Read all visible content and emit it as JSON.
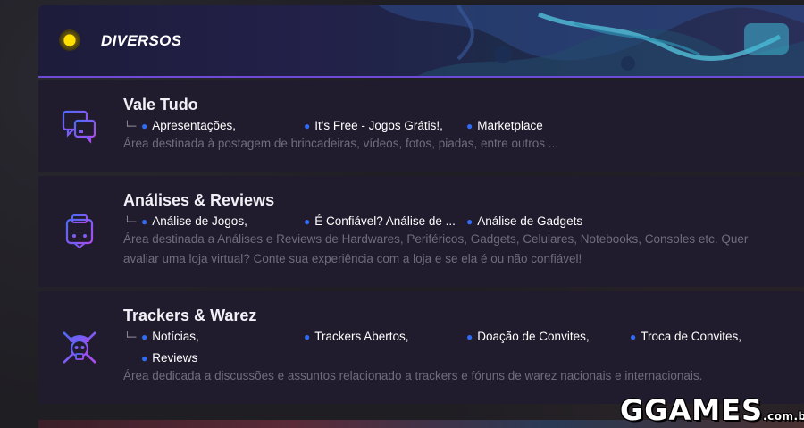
{
  "category": {
    "title": "DIVERSOS"
  },
  "forums": [
    {
      "title": "Vale Tudo",
      "icon": "chat-bubbles-icon",
      "subforums": [
        "Apresentações,",
        "It's Free - Jogos Grátis!,",
        "Marketplace"
      ],
      "description": "Área destinada à postagem de brincadeiras, vídeos, fotos, piadas, entre outros ..."
    },
    {
      "title": "Análises & Reviews",
      "icon": "robot-chip-icon",
      "subforums": [
        "Análise de Jogos,",
        "É Confiável? Análise de ...",
        "Análise de Gadgets"
      ],
      "description_line1": "Área destinada a Análises e Reviews de Hardwares, Periféricos, Gadgets, Celulares, Notebooks, Consoles etc. Quer",
      "description_line2": "avaliar uma loja virtual? Conte sua experiência com a loja e se ela é ou não confiável!"
    },
    {
      "title": "Trackers & Warez",
      "icon": "pirate-skull-icon",
      "subforums": [
        "Notícias,",
        "Trackers Abertos,",
        "Doação de Convites,",
        "Troca de Convites,",
        "Reviews"
      ],
      "description": "Área dedicada a discussões e assuntos relacionado a trackers e fóruns de warez nacionais e internacionais."
    }
  ],
  "watermark": {
    "main": "GGAMES",
    "suffix": ".com.br"
  },
  "colors": {
    "bullet": "#2f6cf6",
    "accent_line": "#6d4bd6",
    "icon_gradient_start": "#4a6cf7",
    "icon_gradient_end": "#b04af0"
  }
}
